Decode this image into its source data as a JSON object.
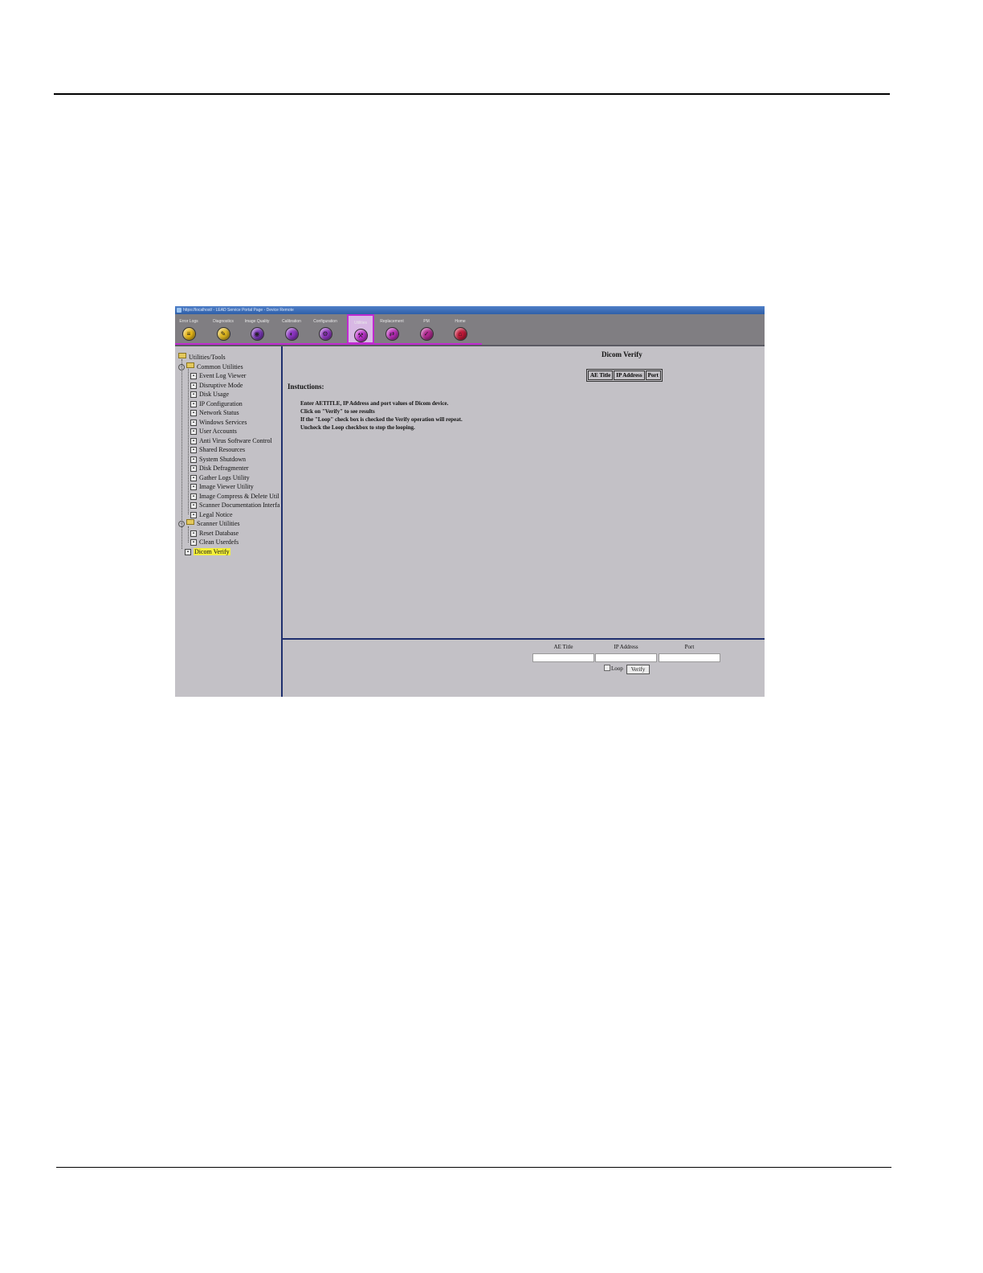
{
  "window": {
    "title": "https://localhost/ - LEAD Service Portal Page - Device Remote"
  },
  "toolbar": {
    "items": [
      {
        "label": "Error Logs",
        "icon": "log-icon",
        "color": "#e8b818"
      },
      {
        "label": "Diagnostics",
        "icon": "diagnostics-icon",
        "color": "#e0b820"
      },
      {
        "label": "Image Quality",
        "icon": "image-quality-icon",
        "color": "#7a36b8"
      },
      {
        "label": "Calibration",
        "icon": "calibration-icon",
        "color": "#8a34c0"
      },
      {
        "label": "Configuration",
        "icon": "configuration-icon",
        "color": "#9036c0"
      },
      {
        "label": "Utilities",
        "icon": "utilities-icon",
        "color": "#c030d0",
        "selected": true
      },
      {
        "label": "Replacement",
        "icon": "replacement-icon",
        "color": "#b82cb8"
      },
      {
        "label": "PM",
        "icon": "pm-icon",
        "color": "#b02890"
      },
      {
        "label": "Home",
        "icon": "home-icon",
        "color": "#c01838"
      }
    ]
  },
  "tree": {
    "root": "Utilities/Tools",
    "groups": [
      {
        "label": "Common Utilities",
        "items": [
          "Event Log Viewer",
          "Disruptive Mode",
          "Disk Usage",
          "IP Configuration",
          "Network Status",
          "Windows Services",
          "User Accounts",
          "Anti Virus Software Control",
          "Shared Resources",
          "System Shutdown",
          "Disk Defragmenter",
          "Gather Logs Utility",
          "Image Viewer Utility",
          "Image Compress & Delete Util",
          "Scanner Documentation Interfa",
          "Legal Notice"
        ]
      },
      {
        "label": "Scanner Utilities",
        "items": [
          "Reset Database",
          "Clean Userdefs"
        ]
      }
    ],
    "selected": "Dicom Verify"
  },
  "main": {
    "title": "Dicom Verify",
    "table_headers": [
      "AE Title",
      "IP Address",
      "Port"
    ],
    "instructions_heading": "Instuctions:",
    "instructions": [
      "Enter AETITLE, IP Address and port values of Dicom device.",
      "Click on \"Verify\" to see results",
      "If the \"Loop\" check box is checked the Verify operation will repeat.",
      "Uncheck the Loop checkbox to stop the looping."
    ]
  },
  "form": {
    "ae_title_label": "AE Title",
    "ip_address_label": "IP Address",
    "port_label": "Port",
    "ae_title_value": "",
    "ip_address_value": "",
    "port_value": "",
    "loop_label": "Loop",
    "loop_checked": false,
    "verify_label": "Verify"
  }
}
